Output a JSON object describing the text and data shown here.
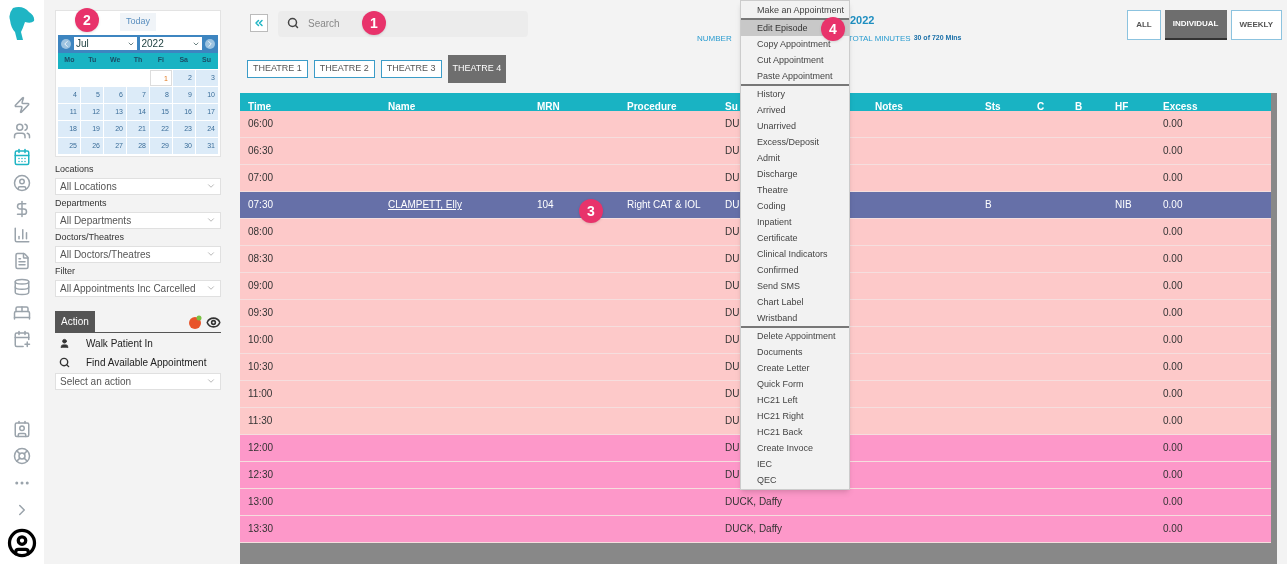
{
  "rail": {
    "items": [
      {
        "kind": "bolt",
        "selected": false
      },
      {
        "kind": "users",
        "selected": false
      },
      {
        "kind": "calendar",
        "selected": true
      },
      {
        "kind": "user",
        "selected": false
      },
      {
        "kind": "dollar",
        "selected": false
      },
      {
        "kind": "chart",
        "selected": false
      },
      {
        "kind": "document",
        "selected": false
      },
      {
        "kind": "database",
        "selected": false
      },
      {
        "kind": "bed",
        "selected": false
      },
      {
        "kind": "calendar-plus",
        "selected": false
      }
    ],
    "bottom": [
      {
        "kind": "staff"
      },
      {
        "kind": "lifebuoy"
      },
      {
        "kind": "dots"
      },
      {
        "kind": "chevron"
      },
      {
        "kind": "account"
      }
    ]
  },
  "sidebar": {
    "today": "Today",
    "calendar": {
      "month": "Jul",
      "year": "2022",
      "weekdays": [
        "Mo",
        "Tu",
        "We",
        "Th",
        "Fi",
        "Sa",
        "Su"
      ],
      "days": [
        {
          "kind": "blank"
        },
        {
          "kind": "blank"
        },
        {
          "kind": "blank"
        },
        {
          "kind": "blank"
        },
        {
          "label": "1",
          "today": true
        },
        {
          "label": "2",
          "today": false
        },
        {
          "label": "3",
          "today": false
        },
        {
          "label": "4",
          "today": false
        },
        {
          "label": "5",
          "today": false
        },
        {
          "label": "6",
          "today": false
        },
        {
          "label": "7",
          "today": false
        },
        {
          "label": "8",
          "today": false
        },
        {
          "label": "9",
          "today": false
        },
        {
          "label": "10",
          "today": false
        },
        {
          "label": "11",
          "today": false
        },
        {
          "label": "12",
          "today": false
        },
        {
          "label": "13",
          "today": false
        },
        {
          "label": "14",
          "today": false
        },
        {
          "label": "15",
          "today": false
        },
        {
          "label": "16",
          "today": false
        },
        {
          "label": "17",
          "today": false
        },
        {
          "label": "18",
          "today": false
        },
        {
          "label": "19",
          "today": false
        },
        {
          "label": "20",
          "today": false
        },
        {
          "label": "21",
          "today": false
        },
        {
          "label": "22",
          "today": false
        },
        {
          "label": "23",
          "today": false
        },
        {
          "label": "24",
          "today": false
        },
        {
          "label": "25",
          "today": false
        },
        {
          "label": "26",
          "today": false
        },
        {
          "label": "27",
          "today": false
        },
        {
          "label": "28",
          "today": false
        },
        {
          "label": "29",
          "today": false
        },
        {
          "label": "30",
          "today": false
        },
        {
          "label": "31",
          "today": false
        }
      ]
    },
    "filters": [
      {
        "label": "Locations",
        "value": "All Locations"
      },
      {
        "label": "Departments",
        "value": "All Departments"
      },
      {
        "label": "Doctors/Theatres",
        "value": "All Doctors/Theatres"
      },
      {
        "label": "Filter",
        "value": "All Appointments Inc Carcelled"
      }
    ],
    "action_tab": "Action",
    "actions": [
      {
        "kind": "person",
        "label": "Walk Patient In"
      },
      {
        "kind": "search",
        "label": "Find Available Appointment"
      }
    ],
    "action_select": "Select an action"
  },
  "search": {
    "placeholder": "Search"
  },
  "tabs": [
    {
      "label": "THEATRE 1",
      "selected": false
    },
    {
      "label": "THEATRE 2",
      "selected": false
    },
    {
      "label": "THEATRE 3",
      "selected": false
    },
    {
      "label": "THEATRE 4",
      "selected": true
    }
  ],
  "summary": {
    "title_visible": "2022",
    "number_label": "NUMBER",
    "minutes_label": "TOTAL MINUTES",
    "minutes_value": "30 of 720 Mins"
  },
  "view_buttons": [
    {
      "label": "ALL",
      "selected": false
    },
    {
      "label": "INDIVIDUAL",
      "selected": true
    },
    {
      "label": "WEEKLY",
      "selected": false
    }
  ],
  "table": {
    "columns": [
      "Time",
      "Name",
      "MRN",
      "Procedure",
      "Su",
      "Notes",
      "Sts",
      "C",
      "B",
      "HF",
      "Excess"
    ],
    "rows": [
      {
        "time": "06:00",
        "su": "DU",
        "excess": "0.00",
        "selected": false,
        "color": "#fdc9c9"
      },
      {
        "time": "06:30",
        "su": "DU",
        "excess": "0.00",
        "selected": false,
        "color": "#fdc9c9"
      },
      {
        "time": "07:00",
        "su": "DU",
        "excess": "0.00",
        "selected": false,
        "color": "#fdc9c9"
      },
      {
        "time": "07:30",
        "name": "CLAMPETT, Elly",
        "mrn": "104",
        "procedure": "Right CAT & IOL",
        "su": "DU",
        "sts": "B",
        "hf": "NIB",
        "excess": "0.00",
        "selected": true
      },
      {
        "time": "08:00",
        "su": "DU",
        "excess": "0.00",
        "selected": false,
        "color": "#fdc9c9"
      },
      {
        "time": "08:30",
        "su": "DU",
        "excess": "0.00",
        "selected": false,
        "color": "#fdc9c9"
      },
      {
        "time": "09:00",
        "su": "DU",
        "excess": "0.00",
        "selected": false,
        "color": "#fdc9c9"
      },
      {
        "time": "09:30",
        "su": "DU",
        "excess": "0.00",
        "selected": false,
        "color": "#fdc9c9"
      },
      {
        "time": "10:00",
        "su": "DU",
        "excess": "0.00",
        "selected": false,
        "color": "#fdc9c9"
      },
      {
        "time": "10:30",
        "su": "DU",
        "excess": "0.00",
        "selected": false,
        "color": "#fdc9c9"
      },
      {
        "time": "11:00",
        "su": "DU",
        "excess": "0.00",
        "selected": false,
        "color": "#fdc9c9"
      },
      {
        "time": "11:30",
        "su": "DU",
        "excess": "0.00",
        "selected": false,
        "color": "#fdc9c9"
      },
      {
        "time": "12:00",
        "su": "DU",
        "excess": "0.00",
        "selected": false,
        "color": "#fd98c9"
      },
      {
        "time": "12:30",
        "su": "DU",
        "excess": "0.00",
        "selected": false,
        "color": "#fd98c9"
      },
      {
        "time": "13:00",
        "su": "DUCK, Daffy",
        "excess": "0.00",
        "selected": false,
        "color": "#fd98c9"
      },
      {
        "time": "13:30",
        "su": "DUCK, Daffy",
        "excess": "0.00",
        "selected": false,
        "color": "#fd98c9"
      }
    ]
  },
  "context_menu": {
    "groups": [
      {
        "items": [
          {
            "label": "Make an Appointment",
            "highlighted": false
          }
        ]
      },
      {
        "items": [
          {
            "label": "Edit Episode",
            "highlighted": true
          },
          {
            "label": "Copy Appointment",
            "highlighted": false
          },
          {
            "label": "Cut Appointment",
            "highlighted": false
          },
          {
            "label": "Paste Appointment",
            "highlighted": false
          }
        ]
      },
      {
        "items": [
          {
            "label": "History",
            "highlighted": false
          },
          {
            "label": "Arrived",
            "highlighted": false
          },
          {
            "label": "Unarrived",
            "highlighted": false
          },
          {
            "label": "Excess/Deposit",
            "highlighted": false
          },
          {
            "label": "Admit",
            "highlighted": false
          },
          {
            "label": "Discharge",
            "highlighted": false
          },
          {
            "label": "Theatre",
            "highlighted": false
          },
          {
            "label": "Coding",
            "highlighted": false
          },
          {
            "label": "Inpatient",
            "highlighted": false
          },
          {
            "label": "Certificate",
            "highlighted": false
          },
          {
            "label": "Clinical Indicators",
            "highlighted": false
          },
          {
            "label": "Confirmed",
            "highlighted": false
          },
          {
            "label": "Send SMS",
            "highlighted": false
          },
          {
            "label": "Chart Label",
            "highlighted": false
          },
          {
            "label": "Wristband",
            "highlighted": false
          }
        ]
      },
      {
        "items": [
          {
            "label": "Delete Appointment",
            "highlighted": false
          },
          {
            "label": "Documents",
            "highlighted": false
          },
          {
            "label": "Create Letter",
            "highlighted": false
          },
          {
            "label": "Quick Form",
            "highlighted": false
          },
          {
            "label": "HC21 Left",
            "highlighted": false
          },
          {
            "label": "HC21 Right",
            "highlighted": false
          },
          {
            "label": "HC21 Back",
            "highlighted": false
          },
          {
            "label": "Create Invoce",
            "highlighted": false
          },
          {
            "label": "IEC",
            "highlighted": false
          },
          {
            "label": "QEC",
            "highlighted": false
          }
        ]
      }
    ]
  },
  "callouts": [
    {
      "label": "2",
      "kind": "calendar"
    },
    {
      "label": "1",
      "kind": "search"
    },
    {
      "label": "4",
      "kind": "menu"
    },
    {
      "label": "3",
      "kind": "row"
    }
  ]
}
